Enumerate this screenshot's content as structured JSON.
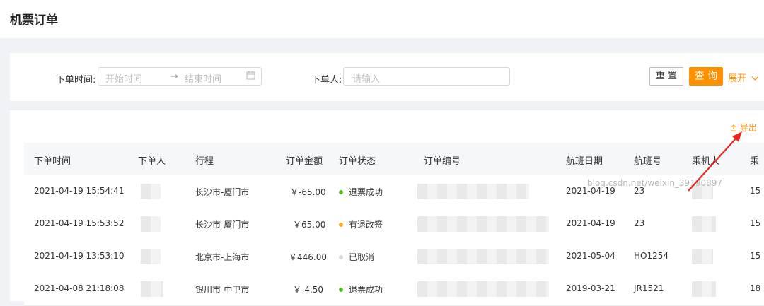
{
  "page": {
    "title": "机票订单"
  },
  "filters": {
    "order_time_label": "下单时间:",
    "start_placeholder": "开始时间",
    "range_arrow": "→",
    "end_placeholder": "结束时间",
    "orderer_label": "下单人:",
    "orderer_placeholder": "请输入",
    "reset_label": "重 置",
    "query_label": "查 询",
    "expand_label": "展开",
    "calendar_icon": "calendar-icon",
    "chevron_icon": "chevron-down-icon"
  },
  "toolbar": {
    "export_label": "导出",
    "export_icon": "upload-icon"
  },
  "table": {
    "headers": [
      "下单时间",
      "下单人",
      "行程",
      "订单金额",
      "订单状态",
      "订单编号",
      "航班日期",
      "航班号",
      "乘机人",
      "乘"
    ],
    "rows": [
      {
        "time": "2021-04-19 15:54:41",
        "route": "长沙市-厦门市",
        "amount": "￥-65.00",
        "status": "退票成功",
        "status_color": "#52c41a",
        "flight_date": "2021-04-19",
        "flight_no": "23",
        "last": "15"
      },
      {
        "time": "2021-04-19 15:53:52",
        "route": "长沙市-厦门市",
        "amount": "￥65.00",
        "status": "有退改签",
        "status_color": "#faad14",
        "flight_date": "2021-04-19",
        "flight_no": "23",
        "last": "15"
      },
      {
        "time": "2021-04-19 13:53:10",
        "route": "北京市-上海市",
        "amount": "￥446.00",
        "status": "已取消",
        "status_color": "#d9d9d9",
        "flight_date": "2021-05-04",
        "flight_no": "HO1254",
        "last": "15"
      },
      {
        "time": "2021-04-08 21:18:08",
        "route": "银川市-中卫市",
        "amount": "￥-4.50",
        "status": "退票成功",
        "status_color": "#52c41a",
        "flight_date": "2019-03-21",
        "flight_no": "JR1521",
        "last": "18"
      }
    ]
  },
  "watermark": "blog.csdn.net/weixin_39190897",
  "annotation_color": "#e8281e"
}
